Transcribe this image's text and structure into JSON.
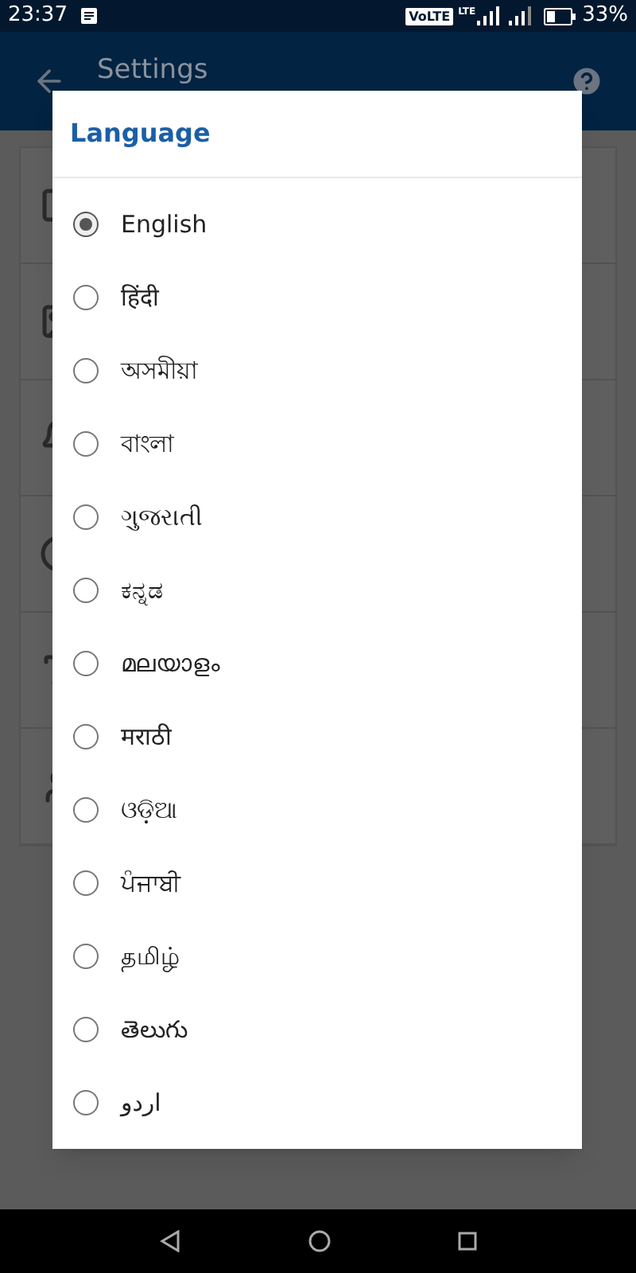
{
  "status_bar": {
    "time": "23:37",
    "volte": "VoLTE",
    "lte": "LTE",
    "battery": "33%"
  },
  "app_bar": {
    "title": "Settings"
  },
  "dialog": {
    "title": "Language",
    "options": [
      {
        "label": "English",
        "selected": true
      },
      {
        "label": "हिंदी",
        "selected": false
      },
      {
        "label": "অসমীয়া",
        "selected": false
      },
      {
        "label": "বাংলা",
        "selected": false
      },
      {
        "label": "ગુજરાતી",
        "selected": false
      },
      {
        "label": "ಕನ್ನಡ",
        "selected": false
      },
      {
        "label": "മലയാളം",
        "selected": false
      },
      {
        "label": "मराठी",
        "selected": false
      },
      {
        "label": "ଓଡ଼ିଆ",
        "selected": false
      },
      {
        "label": "ਪੰਜਾਬੀ",
        "selected": false
      },
      {
        "label": "தமிழ்",
        "selected": false
      },
      {
        "label": "తెలుగు",
        "selected": false
      },
      {
        "label": "اردو",
        "selected": false
      }
    ]
  }
}
